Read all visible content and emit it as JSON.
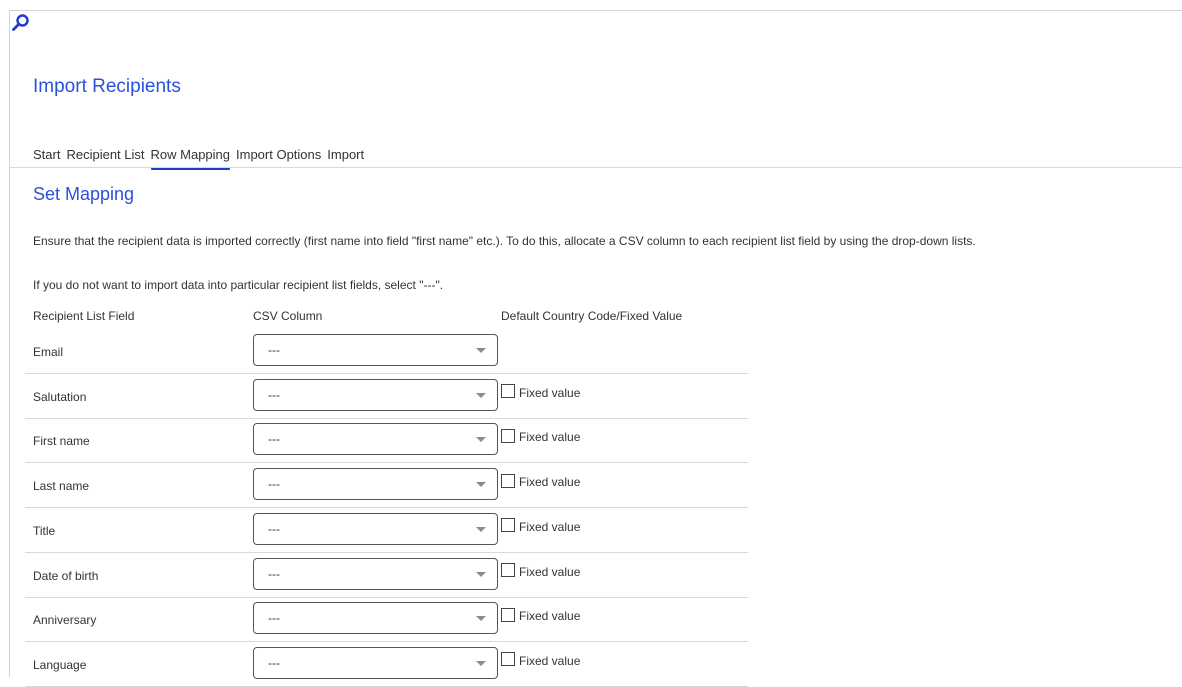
{
  "search": {
    "icon": "search-icon"
  },
  "page_title": "Import Recipients",
  "tabs": [
    {
      "label": "Start",
      "active": false
    },
    {
      "label": "Recipient List",
      "active": false
    },
    {
      "label": "Row Mapping",
      "active": true
    },
    {
      "label": "Import Options",
      "active": false
    },
    {
      "label": "Import",
      "active": false
    }
  ],
  "section_title": "Set Mapping",
  "description": "Ensure that the recipient data is imported correctly (first name into field \"first name\" etc.). To do this, allocate a CSV column to each recipient list field by using the drop-down lists.",
  "hint": "If you do not want to import data into particular recipient list fields, select \"---\".",
  "columns": {
    "field": "Recipient List Field",
    "csv": "CSV Column",
    "default": "Default Country Code/Fixed Value"
  },
  "fixed_value_label": "Fixed value",
  "rows": [
    {
      "field": "Email",
      "csv": "---",
      "has_fixed": false
    },
    {
      "field": "Salutation",
      "csv": "---",
      "has_fixed": true,
      "fixed_label": "Fixed value",
      "checked": false
    },
    {
      "field": "First name",
      "csv": "---",
      "has_fixed": true,
      "fixed_label": "Fixed value",
      "checked": false
    },
    {
      "field": "Last name",
      "csv": "---",
      "has_fixed": true,
      "fixed_label": "Fixed value",
      "checked": false
    },
    {
      "field": "Title",
      "csv": "---",
      "has_fixed": true,
      "fixed_label": "Fixed value",
      "checked": false
    },
    {
      "field": "Date of birth",
      "csv": "---",
      "has_fixed": true,
      "fixed_label": "Fixed value",
      "checked": false
    },
    {
      "field": "Anniversary",
      "csv": "---",
      "has_fixed": true,
      "fixed_label": "Fixed value",
      "checked": false
    },
    {
      "field": "Language",
      "csv": "---",
      "has_fixed": true,
      "fixed_label": "Fixed value",
      "checked": false
    }
  ],
  "colors": {
    "accent": "#2a52d8",
    "tab_underline": "#1f3bd0",
    "divider": "#d9d9d9"
  }
}
